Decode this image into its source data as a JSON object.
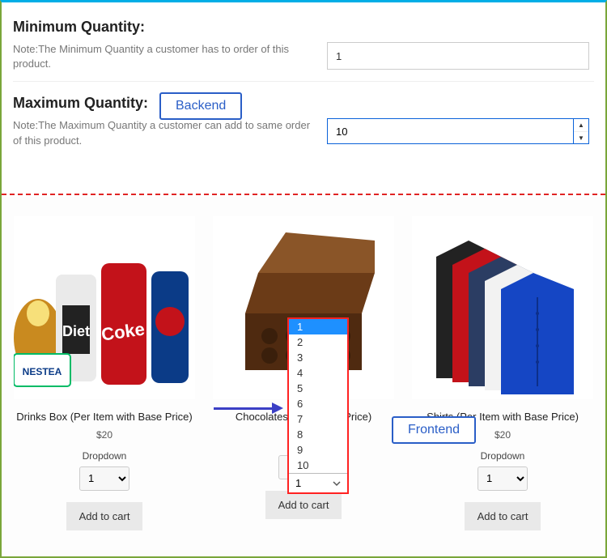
{
  "backend": {
    "min": {
      "heading": "Minimum Quantity:",
      "note": "Note:The Minimum Quantity a customer has to order of this product.",
      "value": "1"
    },
    "max": {
      "heading": "Maximum Quantity:",
      "note": "Note:The Maximum Quantity a customer can add to same order of this product.",
      "value": "10"
    },
    "badge": "Backend"
  },
  "frontend": {
    "badge": "Frontend",
    "dropdown_label": "Dropdown",
    "add_to_cart": "Add to cart",
    "products": [
      {
        "title": "Drinks Box (Per Item with Base Price)",
        "price": "$20",
        "qty": "1"
      },
      {
        "title": "Chocolates Box (Fixed Price)",
        "price": "",
        "qty": "1"
      },
      {
        "title": "Shirts (Per Item with Base Price)",
        "price": "$20",
        "qty": "1"
      }
    ],
    "open_options": [
      "1",
      "2",
      "3",
      "4",
      "5",
      "6",
      "7",
      "8",
      "9",
      "10"
    ],
    "open_selected": "1"
  }
}
